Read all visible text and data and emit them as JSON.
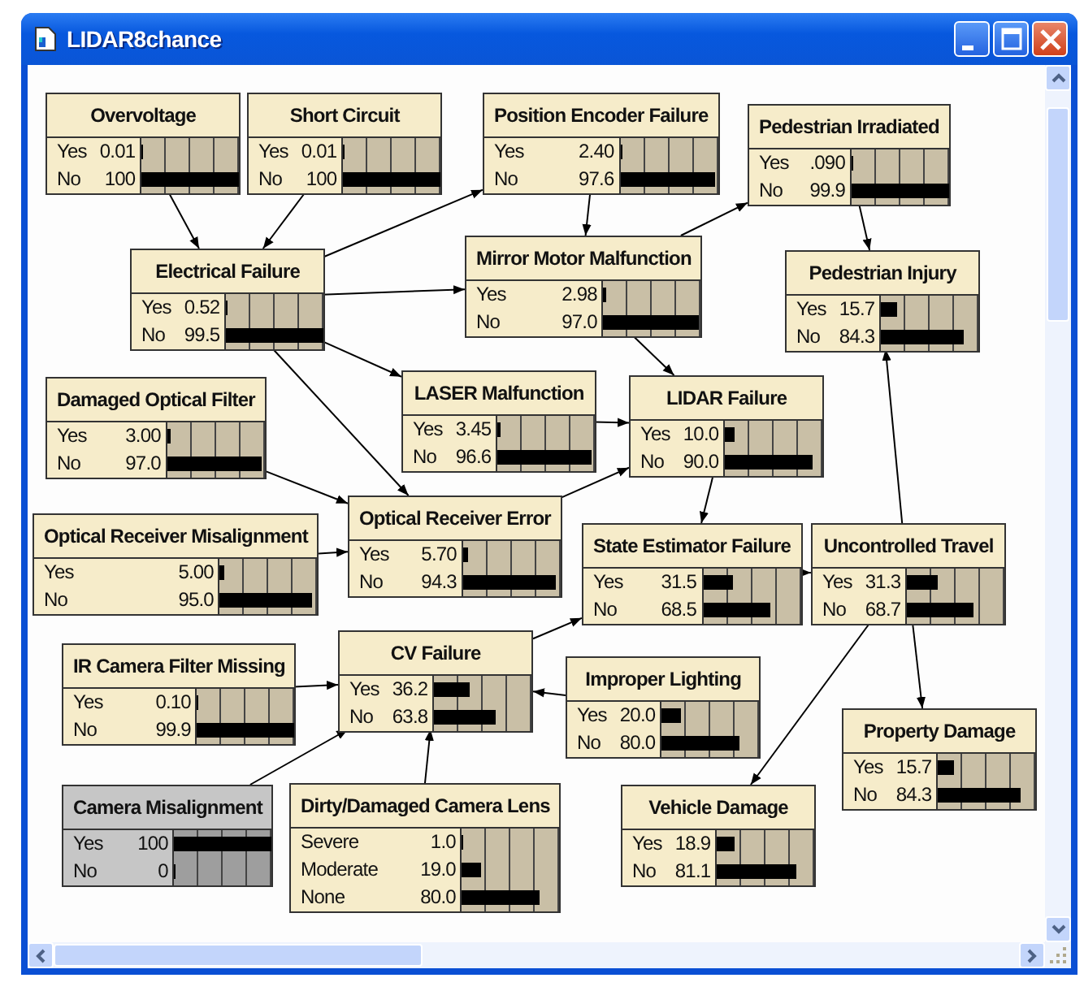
{
  "window": {
    "title": "LIDAR8chance"
  },
  "nodes": [
    {
      "title": "Overvoltage",
      "evidence": false,
      "states": [
        {
          "label": "Yes",
          "value": "0.01",
          "level": 0.0001
        },
        {
          "label": "No",
          "value": "100",
          "level": 1
        }
      ]
    },
    {
      "title": "Short Circuit",
      "evidence": false,
      "states": [
        {
          "label": "Yes",
          "value": "0.01",
          "level": 0.0001
        },
        {
          "label": "No",
          "value": "100",
          "level": 1
        }
      ]
    },
    {
      "title": "Position Encoder Failure",
      "evidence": false,
      "states": [
        {
          "label": "Yes",
          "value": "2.40",
          "level": 0.024
        },
        {
          "label": "No",
          "value": "97.6",
          "level": 0.976
        }
      ]
    },
    {
      "title": "Pedestrian Irradiated",
      "evidence": false,
      "states": [
        {
          "label": "Yes",
          "value": ".090",
          "level": 0.0009
        },
        {
          "label": "No",
          "value": "99.9",
          "level": 0.999
        }
      ]
    },
    {
      "title": "Electrical Failure",
      "evidence": false,
      "states": [
        {
          "label": "Yes",
          "value": "0.52",
          "level": 0.0052
        },
        {
          "label": "No",
          "value": "99.5",
          "level": 0.995
        }
      ]
    },
    {
      "title": "Mirror Motor Malfunction",
      "evidence": false,
      "states": [
        {
          "label": "Yes",
          "value": "2.98",
          "level": 0.0298
        },
        {
          "label": "No",
          "value": "97.0",
          "level": 0.97
        }
      ]
    },
    {
      "title": "Pedestrian Injury",
      "evidence": false,
      "states": [
        {
          "label": "Yes",
          "value": "15.7",
          "level": 0.157
        },
        {
          "label": "No",
          "value": "84.3",
          "level": 0.843
        }
      ]
    },
    {
      "title": "Damaged Optical Filter",
      "evidence": false,
      "states": [
        {
          "label": "Yes",
          "value": "3.00",
          "level": 0.03
        },
        {
          "label": "No",
          "value": "97.0",
          "level": 0.97
        }
      ]
    },
    {
      "title": "LASER Malfunction",
      "evidence": false,
      "states": [
        {
          "label": "Yes",
          "value": "3.45",
          "level": 0.0345
        },
        {
          "label": "No",
          "value": "96.6",
          "level": 0.966
        }
      ]
    },
    {
      "title": "LIDAR Failure",
      "evidence": false,
      "states": [
        {
          "label": "Yes",
          "value": "10.0",
          "level": 0.1
        },
        {
          "label": "No",
          "value": "90.0",
          "level": 0.9
        }
      ]
    },
    {
      "title": "Optical Receiver Misalignment",
      "evidence": false,
      "states": [
        {
          "label": "Yes",
          "value": "5.00",
          "level": 0.05
        },
        {
          "label": "No",
          "value": "95.0",
          "level": 0.95
        }
      ]
    },
    {
      "title": "Optical Receiver Error",
      "evidence": false,
      "states": [
        {
          "label": "Yes",
          "value": "5.70",
          "level": 0.057
        },
        {
          "label": "No",
          "value": "94.3",
          "level": 0.943
        }
      ]
    },
    {
      "title": "State Estimator Failure",
      "evidence": false,
      "states": [
        {
          "label": "Yes",
          "value": "31.5",
          "level": 0.315
        },
        {
          "label": "No",
          "value": "68.5",
          "level": 0.685
        }
      ]
    },
    {
      "title": "Uncontrolled Travel",
      "evidence": false,
      "states": [
        {
          "label": "Yes",
          "value": "31.3",
          "level": 0.313
        },
        {
          "label": "No",
          "value": "68.7",
          "level": 0.687
        }
      ]
    },
    {
      "title": "IR Camera Filter Missing",
      "evidence": false,
      "states": [
        {
          "label": "Yes",
          "value": "0.10",
          "level": 0.001
        },
        {
          "label": "No",
          "value": "99.9",
          "level": 0.999
        }
      ]
    },
    {
      "title": "CV Failure",
      "evidence": false,
      "states": [
        {
          "label": "Yes",
          "value": "36.2",
          "level": 0.362
        },
        {
          "label": "No",
          "value": "63.8",
          "level": 0.638
        }
      ]
    },
    {
      "title": "Improper Lighting",
      "evidence": false,
      "states": [
        {
          "label": "Yes",
          "value": "20.0",
          "level": 0.2
        },
        {
          "label": "No",
          "value": "80.0",
          "level": 0.8
        }
      ]
    },
    {
      "title": "Camera Misalignment",
      "evidence": true,
      "states": [
        {
          "label": "Yes",
          "value": "100",
          "level": 1
        },
        {
          "label": "No",
          "value": "0",
          "level": 0
        }
      ]
    },
    {
      "title": "Dirty/Damaged Camera Lens",
      "evidence": false,
      "states": [
        {
          "label": "Severe",
          "value": "1.0",
          "level": 0.01
        },
        {
          "label": "Moderate",
          "value": "19.0",
          "level": 0.19
        },
        {
          "label": "None",
          "value": "80.0",
          "level": 0.8
        }
      ]
    },
    {
      "title": "Vehicle Damage",
      "evidence": false,
      "states": [
        {
          "label": "Yes",
          "value": "18.9",
          "level": 0.189
        },
        {
          "label": "No",
          "value": "81.1",
          "level": 0.811
        }
      ]
    },
    {
      "title": "Property Damage",
      "evidence": false,
      "states": [
        {
          "label": "Yes",
          "value": "15.7",
          "level": 0.157
        },
        {
          "label": "No",
          "value": "84.3",
          "level": 0.843
        }
      ]
    }
  ]
}
